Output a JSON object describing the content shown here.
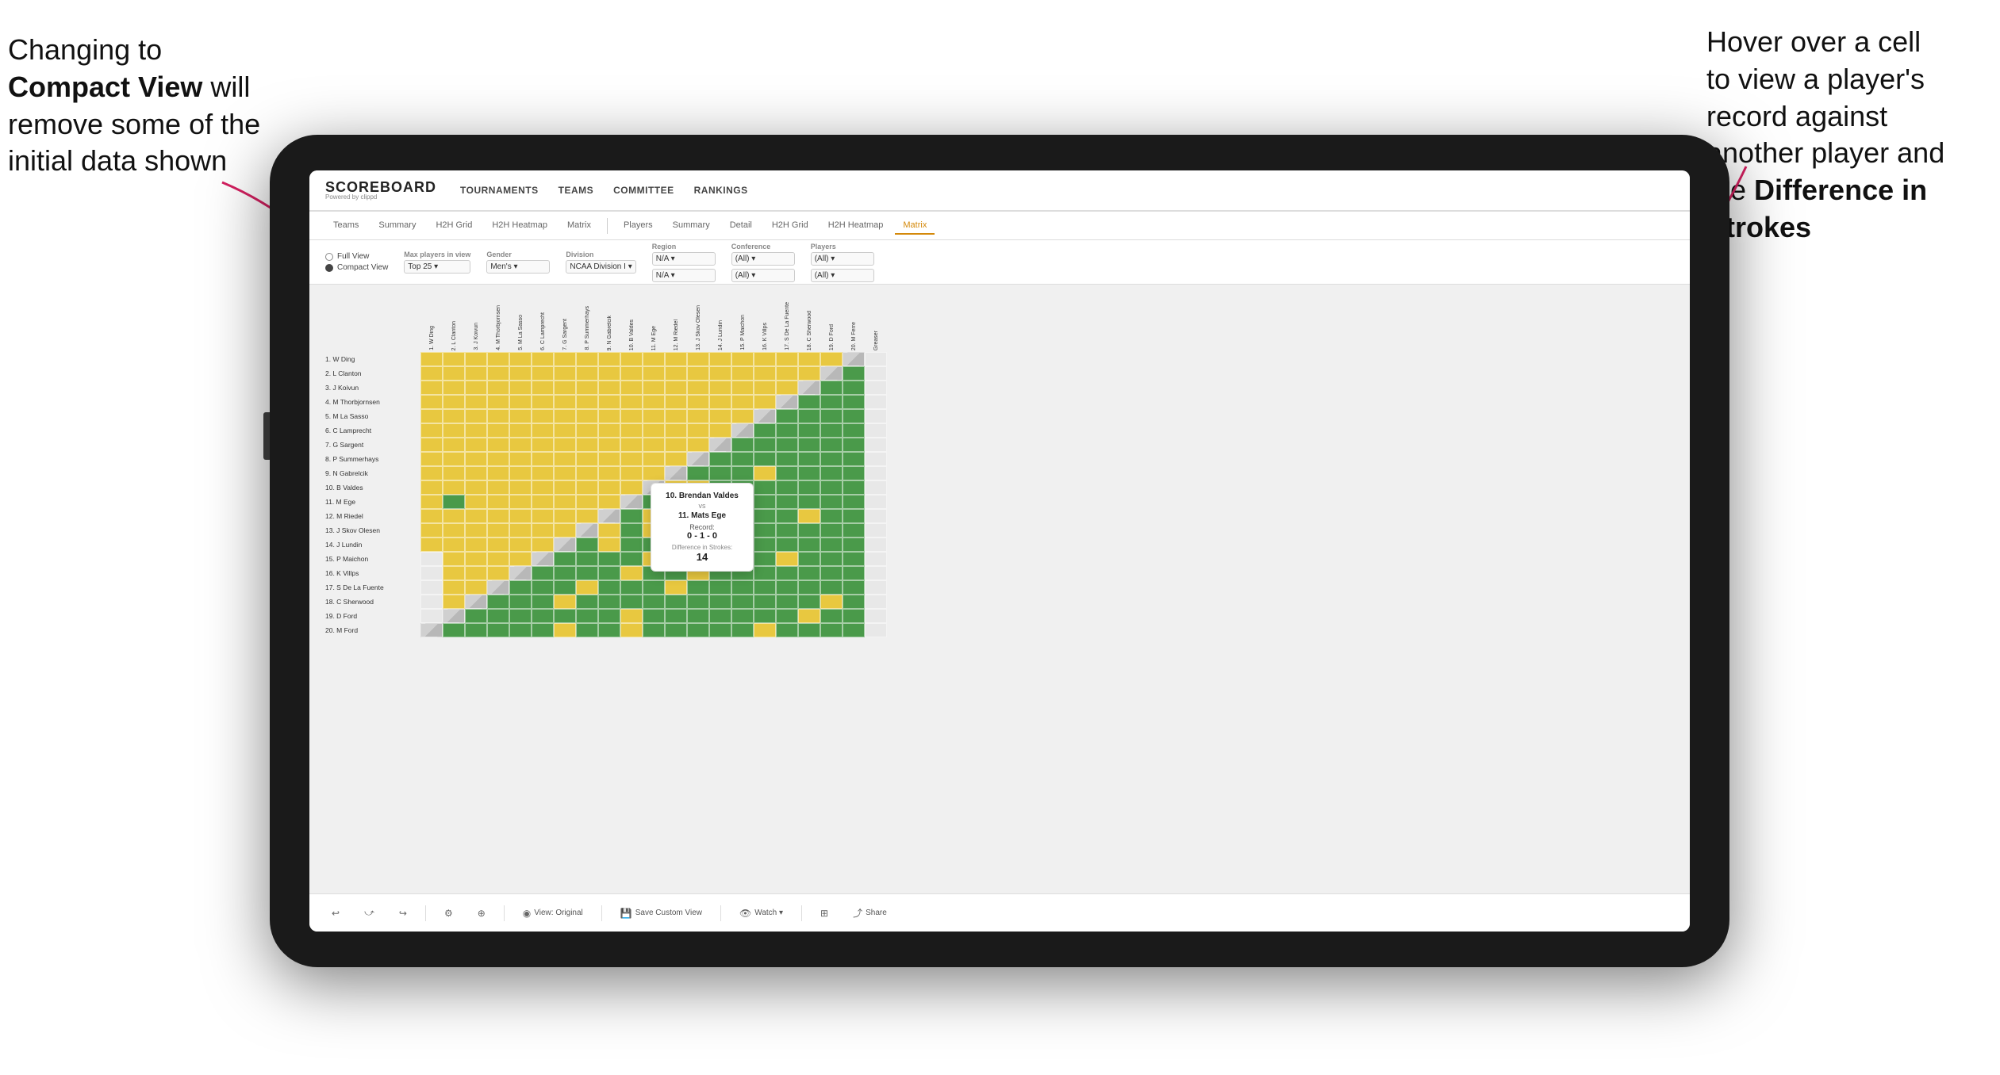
{
  "annotations": {
    "left": {
      "line1": "Changing to",
      "line2_bold": "Compact View",
      "line2_rest": " will",
      "line3": "remove some of the",
      "line4": "initial data shown"
    },
    "right": {
      "line1": "Hover over a cell",
      "line2": "to view a player's",
      "line3": "record against",
      "line4": "another player and",
      "line5": "the ",
      "line5_bold": "Difference in",
      "line6_bold": "Strokes"
    }
  },
  "header": {
    "logo": "SCOREBOARD",
    "logo_sub": "Powered by clippd",
    "nav": [
      "TOURNAMENTS",
      "TEAMS",
      "COMMITTEE",
      "RANKINGS"
    ]
  },
  "sub_nav_left": [
    "Teams",
    "Summary",
    "H2H Grid",
    "H2H Heatmap",
    "Matrix"
  ],
  "sub_nav_right": [
    "Players",
    "Summary",
    "Detail",
    "H2H Grid",
    "H2H Heatmap",
    "Matrix"
  ],
  "sub_nav_active": "Matrix",
  "controls": {
    "view_options": [
      "Full View",
      "Compact View"
    ],
    "view_selected": "Compact View",
    "max_players_label": "Max players in view",
    "max_players_value": "Top 25",
    "gender_label": "Gender",
    "gender_value": "Men's",
    "division_label": "Division",
    "division_value": "NCAA Division I",
    "region_label": "Region",
    "region_values": [
      "N/A",
      "N/A"
    ],
    "conference_label": "Conference",
    "conference_values": [
      "(All)",
      "(All)"
    ],
    "players_label": "Players",
    "players_values": [
      "(All)",
      "(All)"
    ]
  },
  "column_headers": [
    "1. W Ding",
    "2. L Clanton",
    "3. J Koivun",
    "4. M Thorbjornsen",
    "5. M La Sasso",
    "6. C Lamprecht",
    "7. G Sargent",
    "8. P Summerhays",
    "9. N Gabrelcik",
    "10. B Valdes",
    "11. M Ege",
    "12. M Riedel",
    "13. J Skov Olesen",
    "14. J Lundin",
    "15. P Maichon",
    "16. K Villps",
    "17. S De La Fuente",
    "18. C Sherwood",
    "19. D Ford",
    "20. M Ferre",
    "Greaser"
  ],
  "players": [
    "1. W Ding",
    "2. L Clanton",
    "3. J Koivun",
    "4. M Thorbjornsen",
    "5. M La Sasso",
    "6. C Lamprecht",
    "7. G Sargent",
    "8. P Summerhays",
    "9. N Gabrelcik",
    "10. B Valdes",
    "11. M Ege",
    "12. M Riedel",
    "13. J Skov Olesen",
    "14. J Lundin",
    "15. P Maichon",
    "16. K Villps",
    "17. S De La Fuente",
    "18. C Sherwood",
    "19. D Ford",
    "20. M Ford"
  ],
  "tooltip": {
    "player1": "10. Brendan Valdes",
    "vs": "vs",
    "player2": "11. Mats Ege",
    "record_label": "Record:",
    "record": "0 - 1 - 0",
    "diff_label": "Difference in Strokes:",
    "diff": "14"
  },
  "toolbar": {
    "undo": "↩",
    "redo": "↪",
    "view_original": "View: Original",
    "save_custom": "Save Custom View",
    "watch": "Watch ▾",
    "share": "Share"
  },
  "colors": {
    "green": "#4a9a4a",
    "yellow": "#e8c840",
    "gray": "#c8c8c8",
    "white": "#f0f0f0",
    "active_tab": "#d4890a",
    "brand": "#222222"
  },
  "grid_pattern": [
    [
      "d",
      "g",
      "g",
      "g",
      "g",
      "g",
      "y",
      "g",
      "g",
      "y",
      "g",
      "g",
      "g",
      "g",
      "g",
      "y",
      "g",
      "g",
      "g",
      "g",
      "w"
    ],
    [
      "w",
      "d",
      "g",
      "g",
      "g",
      "g",
      "g",
      "g",
      "g",
      "y",
      "g",
      "g",
      "g",
      "g",
      "g",
      "g",
      "g",
      "y",
      "g",
      "g",
      "w"
    ],
    [
      "w",
      "y",
      "d",
      "g",
      "g",
      "g",
      "y",
      "g",
      "g",
      "g",
      "g",
      "g",
      "g",
      "g",
      "g",
      "g",
      "g",
      "g",
      "y",
      "g",
      "w"
    ],
    [
      "w",
      "y",
      "y",
      "d",
      "g",
      "g",
      "g",
      "y",
      "g",
      "g",
      "g",
      "y",
      "g",
      "g",
      "g",
      "g",
      "g",
      "g",
      "g",
      "g",
      "w"
    ],
    [
      "w",
      "y",
      "y",
      "y",
      "d",
      "g",
      "g",
      "g",
      "g",
      "y",
      "g",
      "g",
      "y",
      "g",
      "g",
      "g",
      "g",
      "g",
      "g",
      "g",
      "w"
    ],
    [
      "w",
      "y",
      "y",
      "y",
      "y",
      "d",
      "g",
      "g",
      "g",
      "g",
      "y",
      "g",
      "g",
      "g",
      "g",
      "g",
      "y",
      "g",
      "g",
      "g",
      "w"
    ],
    [
      "y",
      "y",
      "y",
      "y",
      "y",
      "y",
      "d",
      "g",
      "y",
      "g",
      "g",
      "y",
      "g",
      "g",
      "g",
      "g",
      "g",
      "g",
      "g",
      "g",
      "w"
    ],
    [
      "y",
      "y",
      "y",
      "y",
      "y",
      "y",
      "y",
      "d",
      "y",
      "g",
      "y",
      "g",
      "g",
      "g",
      "g",
      "g",
      "g",
      "g",
      "g",
      "g",
      "w"
    ],
    [
      "y",
      "y",
      "y",
      "y",
      "y",
      "y",
      "y",
      "y",
      "d",
      "g",
      "y",
      "g",
      "y",
      "g",
      "g",
      "g",
      "g",
      "y",
      "g",
      "g",
      "w"
    ],
    [
      "y",
      "g",
      "y",
      "y",
      "y",
      "y",
      "y",
      "y",
      "y",
      "d",
      "g",
      "y",
      "g",
      "g",
      "g",
      "g",
      "g",
      "g",
      "g",
      "g",
      "w"
    ],
    [
      "y",
      "y",
      "y",
      "y",
      "y",
      "y",
      "y",
      "y",
      "y",
      "y",
      "d",
      "y",
      "y",
      "g",
      "g",
      "g",
      "g",
      "g",
      "g",
      "g",
      "w"
    ],
    [
      "y",
      "y",
      "y",
      "y",
      "y",
      "y",
      "y",
      "y",
      "y",
      "y",
      "y",
      "d",
      "g",
      "g",
      "g",
      "y",
      "g",
      "g",
      "g",
      "g",
      "w"
    ],
    [
      "y",
      "y",
      "y",
      "y",
      "y",
      "y",
      "y",
      "y",
      "y",
      "y",
      "y",
      "y",
      "d",
      "g",
      "g",
      "g",
      "g",
      "g",
      "g",
      "g",
      "w"
    ],
    [
      "y",
      "y",
      "y",
      "y",
      "y",
      "y",
      "y",
      "y",
      "y",
      "y",
      "y",
      "y",
      "y",
      "d",
      "g",
      "g",
      "g",
      "g",
      "g",
      "g",
      "w"
    ],
    [
      "y",
      "y",
      "y",
      "y",
      "y",
      "y",
      "y",
      "y",
      "y",
      "y",
      "y",
      "y",
      "y",
      "y",
      "d",
      "g",
      "g",
      "g",
      "g",
      "g",
      "w"
    ],
    [
      "y",
      "y",
      "y",
      "y",
      "y",
      "y",
      "y",
      "y",
      "y",
      "y",
      "y",
      "y",
      "y",
      "y",
      "y",
      "d",
      "g",
      "g",
      "g",
      "g",
      "w"
    ],
    [
      "y",
      "y",
      "y",
      "y",
      "y",
      "y",
      "y",
      "y",
      "y",
      "y",
      "y",
      "y",
      "y",
      "y",
      "y",
      "y",
      "d",
      "g",
      "g",
      "g",
      "w"
    ],
    [
      "y",
      "y",
      "y",
      "y",
      "y",
      "y",
      "y",
      "y",
      "y",
      "y",
      "y",
      "y",
      "y",
      "y",
      "y",
      "y",
      "y",
      "d",
      "g",
      "g",
      "w"
    ],
    [
      "y",
      "y",
      "y",
      "y",
      "y",
      "y",
      "y",
      "y",
      "y",
      "y",
      "y",
      "y",
      "y",
      "y",
      "y",
      "y",
      "y",
      "y",
      "d",
      "g",
      "w"
    ],
    [
      "y",
      "y",
      "y",
      "y",
      "y",
      "y",
      "y",
      "y",
      "y",
      "y",
      "y",
      "y",
      "y",
      "y",
      "y",
      "y",
      "y",
      "y",
      "y",
      "d",
      "w"
    ]
  ]
}
